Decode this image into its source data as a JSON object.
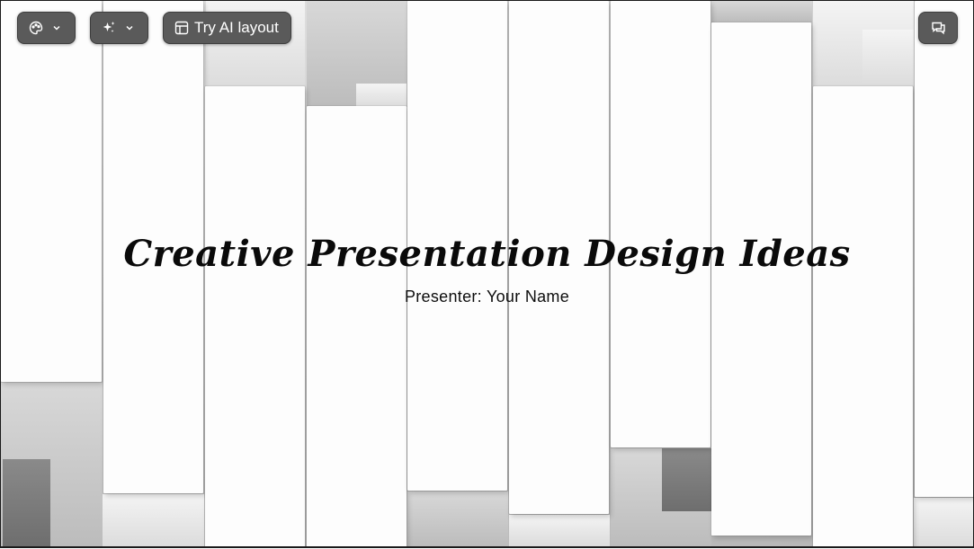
{
  "toolbar": {
    "theme_button_icon": "palette-icon",
    "ai_button_icon": "sparkle-icon",
    "dropdown_icon": "chevron-down-icon",
    "layout_button_icon": "layout-icon",
    "layout_button_label": "Try AI layout",
    "comments_button_icon": "comment-icon"
  },
  "slide": {
    "title": "Creative Presentation Design Ideas",
    "subtitle": "Presenter: Your Name"
  }
}
